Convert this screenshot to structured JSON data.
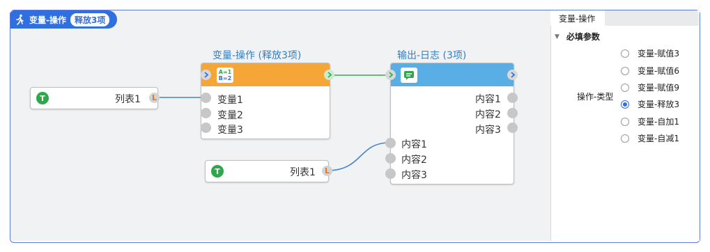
{
  "header": {
    "title": "变量-操作",
    "badge": "释放3项",
    "icon": "run-icon"
  },
  "nodes": {
    "source1": {
      "label": "列表1",
      "type_icon": "T",
      "port_icon": "L"
    },
    "source2": {
      "label": "列表1",
      "type_icon": "T",
      "port_icon": "L"
    },
    "var_op": {
      "title": "变量-操作 (释放3项)",
      "icon_line1": "A=1",
      "icon_line2": "B=2",
      "ports": [
        "变量1",
        "变量2",
        "变量3"
      ],
      "color": "#f5a637"
    },
    "log_out": {
      "title": "输出-日志 (3项)",
      "outputs": [
        "内容1",
        "内容2",
        "内容3"
      ],
      "inputs": [
        "内容1",
        "内容2",
        "内容3"
      ],
      "color": "#5aaee6"
    }
  },
  "panel": {
    "tab": "变量-操作",
    "section": "必填参数",
    "field_label": "操作-类型",
    "options": [
      {
        "label": "变量-赋值3",
        "checked": false
      },
      {
        "label": "变量-赋值6",
        "checked": false
      },
      {
        "label": "变量-赋值9",
        "checked": false
      },
      {
        "label": "变量-释放3",
        "checked": true
      },
      {
        "label": "变量-自加1",
        "checked": false
      },
      {
        "label": "变量-自减1",
        "checked": false
      }
    ]
  },
  "colors": {
    "accent": "#2f6fe0",
    "wire_data": "#3f86cf",
    "wire_flow": "#2cb24a"
  }
}
